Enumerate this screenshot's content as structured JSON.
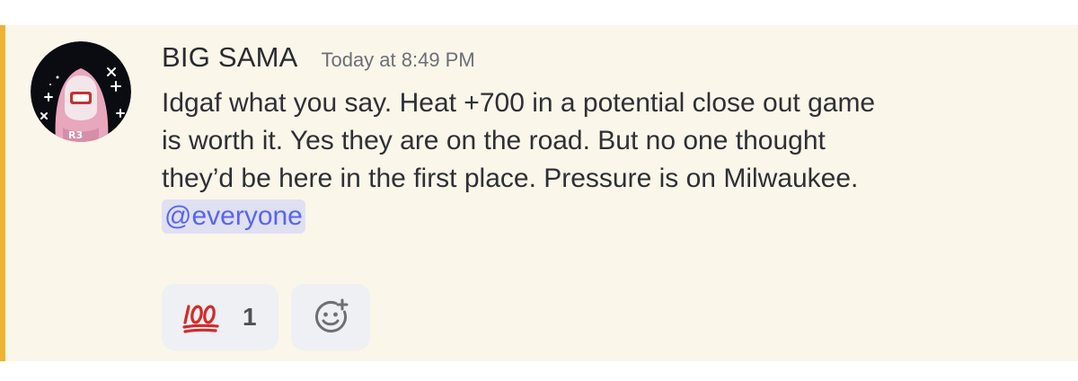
{
  "message": {
    "author": "BIG SAMA",
    "timestamp": "Today at 8:49 PM",
    "lines": [
      "Idgaf what you say. Heat +700 in a potential close out game",
      "is worth it. Yes they are on the road. But no one thought",
      "they’d be here in the first place. Pressure is on Milwaukee."
    ],
    "mention": "@everyone",
    "highlighted": true,
    "avatar": {
      "icon": "pink-hoodie-character-avatar",
      "badge_text": "R3"
    }
  },
  "reactions": [
    {
      "emoji": "💯",
      "emoji_name": "hundred-points-icon",
      "count": "1"
    }
  ],
  "add_reaction": {
    "icon": "add-reaction-icon"
  },
  "colors": {
    "highlight_background": "#faf6ea",
    "highlight_bar": "#f0b232",
    "mention_text": "#5865f2",
    "mention_background": "#dfe0f2",
    "reaction_background": "#eef0f3"
  }
}
